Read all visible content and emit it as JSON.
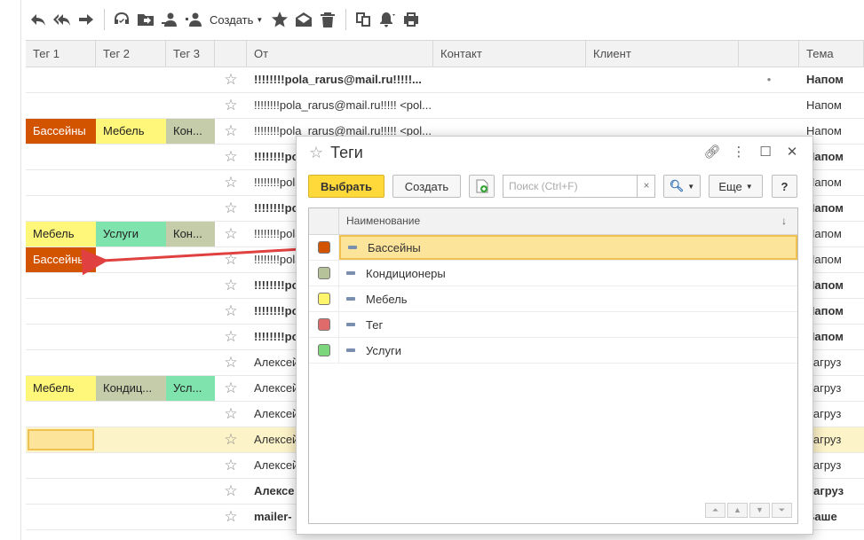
{
  "toolbar": {
    "create_label": "Создать"
  },
  "grid": {
    "columns": [
      "Тег 1",
      "Тег 2",
      "Тег 3",
      "",
      "От",
      "Контакт",
      "Клиент",
      "",
      "Тема"
    ],
    "rows": [
      {
        "t1": "",
        "t2": "",
        "t3": "",
        "from": "!!!!!!!!pola_rarus@mail.ru!!!!!...",
        "extra": "•",
        "subject": "Напом",
        "bold": true
      },
      {
        "t1": "",
        "t2": "",
        "t3": "",
        "from": "!!!!!!!!pola_rarus@mail.ru!!!!! <pol...",
        "extra": "",
        "subject": "Напом",
        "bold": false
      },
      {
        "t1": "Бассейны",
        "t2": "Мебель",
        "t3": "Кон...",
        "from": "!!!!!!!!pola_rarus@mail.ru!!!!! <pol...",
        "extra": "",
        "subject": "Напом",
        "bold": false
      },
      {
        "t1": "",
        "t2": "",
        "t3": "",
        "from": "!!!!!!!!po",
        "extra": "",
        "subject": "Напом",
        "bold": true
      },
      {
        "t1": "",
        "t2": "",
        "t3": "",
        "from": "!!!!!!!!pola",
        "extra": "",
        "subject": "Напом",
        "bold": false
      },
      {
        "t1": "",
        "t2": "",
        "t3": "",
        "from": "!!!!!!!!po",
        "extra": "",
        "subject": "Напом",
        "bold": true
      },
      {
        "t1": "Мебель",
        "t2": "Услуги",
        "t3": "Кон...",
        "from": "!!!!!!!!pola",
        "extra": "",
        "subject": "Напом",
        "bold": false
      },
      {
        "t1": "Бассейны",
        "t2": "",
        "t3": "",
        "from": "!!!!!!!!pola",
        "extra": "",
        "subject": "Напом",
        "bold": false
      },
      {
        "t1": "",
        "t2": "",
        "t3": "",
        "from": "!!!!!!!!po",
        "extra": "",
        "subject": "Напом",
        "bold": true
      },
      {
        "t1": "",
        "t2": "",
        "t3": "",
        "from": "!!!!!!!!po",
        "extra": "",
        "subject": "Напом",
        "bold": true
      },
      {
        "t1": "",
        "t2": "",
        "t3": "",
        "from": "!!!!!!!!po",
        "extra": "",
        "subject": "Напом",
        "bold": true
      },
      {
        "t1": "",
        "t2": "",
        "t3": "",
        "from": "Алексей",
        "extra": "",
        "subject": "Загруз",
        "bold": false
      },
      {
        "t1": "Мебель",
        "t2": "Кондиц...",
        "t3": "Усл...",
        "from": "Алексей",
        "extra": "",
        "subject": "Загруз",
        "bold": false
      },
      {
        "t1": "",
        "t2": "",
        "t3": "",
        "from": "Алексей",
        "extra": "",
        "subject": "Загруз",
        "bold": false
      },
      {
        "t1": "",
        "t2": "",
        "t3": "",
        "from": "Алексей",
        "extra": "",
        "subject": "Загруз",
        "bold": false
      },
      {
        "t1": "",
        "t2": "",
        "t3": "",
        "from": "Алексей",
        "extra": "",
        "subject": "Загруз",
        "bold": false
      },
      {
        "t1": "",
        "t2": "",
        "t3": "",
        "from": "Алексе",
        "extra": "",
        "subject": "Загруз",
        "bold": true
      },
      {
        "t1": "",
        "t2": "",
        "t3": "",
        "from": "mailer-",
        "extra": "",
        "subject": "Ваше",
        "bold": true
      }
    ],
    "selected_row": 14
  },
  "tag_colors": {
    "Бассейны": "#d35400",
    "Кондиционеры": "#c5ccaa",
    "Мебель": "#fff77a",
    "Тег": "#e57373",
    "Услуги": "#7fe3ad"
  },
  "dialog": {
    "title": "Теги",
    "select_label": "Выбрать",
    "create_label": "Создать",
    "search_placeholder": "Поиск (Ctrl+F)",
    "search_clear": "×",
    "more_label": "Еще",
    "help_label": "?",
    "column_name": "Наименование",
    "sort_glyph": "↓",
    "items": [
      {
        "name": "Бассейны",
        "color": "#d35400"
      },
      {
        "name": "Кондиционеры",
        "color": "#b5c29a"
      },
      {
        "name": "Мебель",
        "color": "#fff56a"
      },
      {
        "name": "Тег",
        "color": "#e06b6b"
      },
      {
        "name": "Услуги",
        "color": "#7cd67c"
      }
    ],
    "selected_index": 0
  }
}
